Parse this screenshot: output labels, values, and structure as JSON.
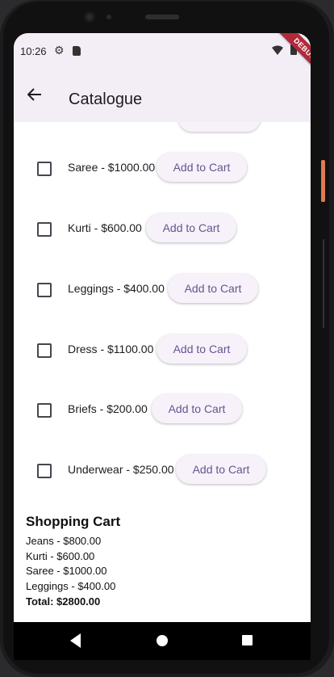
{
  "status_bar": {
    "time": "10:26",
    "icons": [
      "gear-icon",
      "sim-card-icon",
      "wifi-icon",
      "battery-icon"
    ]
  },
  "debug_banner": "DEBUG",
  "app_bar": {
    "title": "Catalogue",
    "back_icon": "arrow-left-icon"
  },
  "catalog": {
    "items": [
      {
        "label": "Saree - $1000.00",
        "button": "Add to Cart",
        "checked": false
      },
      {
        "label": "Kurti - $600.00",
        "button": "Add to Cart",
        "checked": false
      },
      {
        "label": "Leggings - $400.00",
        "button": "Add to Cart",
        "checked": false
      },
      {
        "label": "Dress - $1100.00",
        "button": "Add to Cart",
        "checked": false
      },
      {
        "label": "Briefs - $200.00",
        "button": "Add to Cart",
        "checked": false
      },
      {
        "label": "Underwear - $250.00",
        "button": "Add to Cart",
        "checked": false
      }
    ]
  },
  "cart": {
    "title": "Shopping Cart",
    "items": [
      "Jeans - $800.00",
      "Kurti - $600.00",
      "Saree - $1000.00",
      "Leggings - $400.00"
    ],
    "total": "Total: $2800.00"
  },
  "colors": {
    "app_bar_bg": "#f3eef6",
    "button_text": "#65558f",
    "button_bg": "#f7f2fa",
    "debug_banner": "#b22a3a"
  }
}
